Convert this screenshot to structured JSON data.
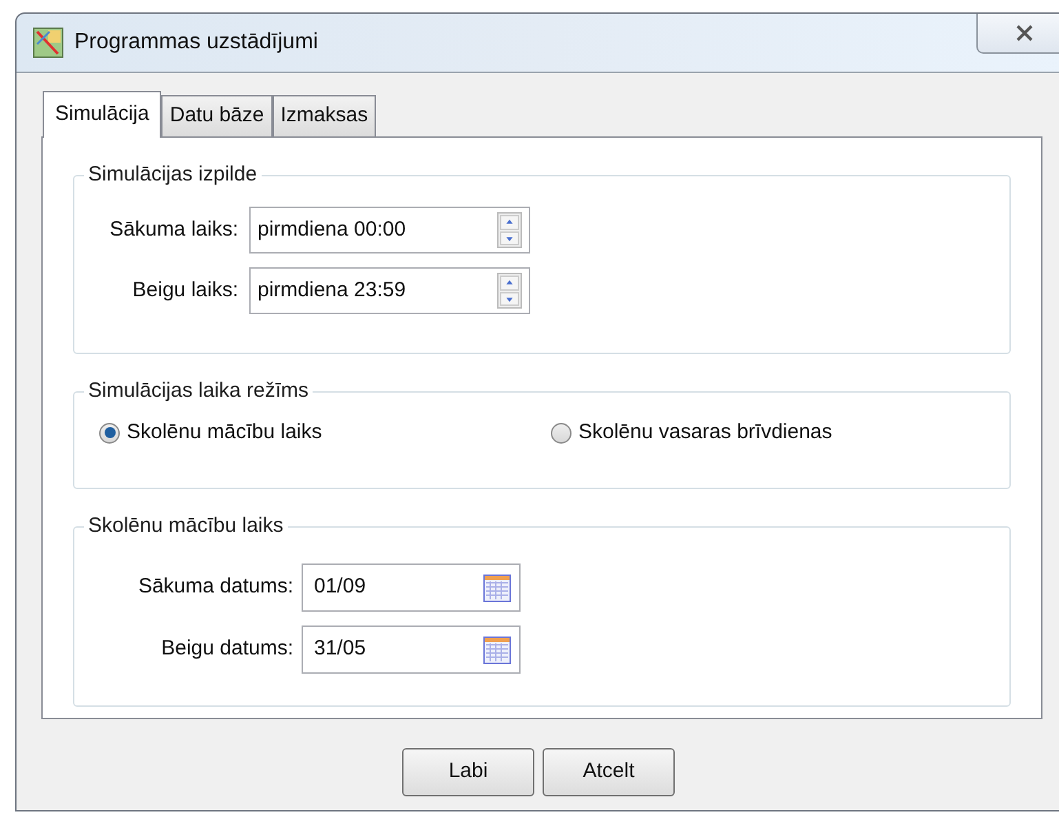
{
  "window": {
    "title": "Programmas uzstādījumi"
  },
  "tabs": [
    {
      "label": "Simulācija",
      "selected": true
    },
    {
      "label": "Datu bāze",
      "selected": false
    },
    {
      "label": "Izmaksas",
      "selected": false
    }
  ],
  "execution": {
    "title": "Simulācijas izpilde",
    "fields": [
      {
        "label": "Sākuma laiks:",
        "value": "pirmdiena 00:00"
      },
      {
        "label": "Beigu laiks:",
        "value": "pirmdiena 23:59"
      }
    ]
  },
  "time_mode": {
    "title": "Simulācijas laika režīms",
    "options": [
      {
        "label": "Skolēnu mācību laiks",
        "selected": true
      },
      {
        "label": "Skolēnu vasaras brīvdienas",
        "selected": false
      }
    ]
  },
  "school_time": {
    "title": "Skolēnu mācību laiks",
    "fields": [
      {
        "label": "Sākuma datums:",
        "value": "01/09"
      },
      {
        "label": "Beigu datums:",
        "value": "31/05"
      }
    ]
  },
  "buttons": [
    "Labi",
    "Atcelt"
  ]
}
